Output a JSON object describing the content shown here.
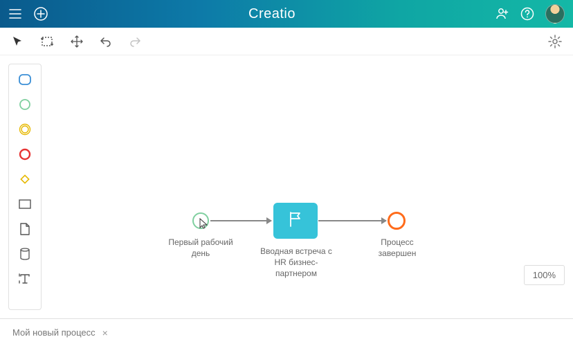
{
  "header": {
    "brand": "Creatio"
  },
  "toolbar": {},
  "canvas": {
    "start_label": "Первый рабочий день",
    "task_label": "Вводная встреча с HR бизнес-партнером",
    "end_label": "Процесс завершен"
  },
  "zoom": {
    "level": "100%"
  },
  "footer": {
    "tab_label": "Мой новый процесс"
  }
}
